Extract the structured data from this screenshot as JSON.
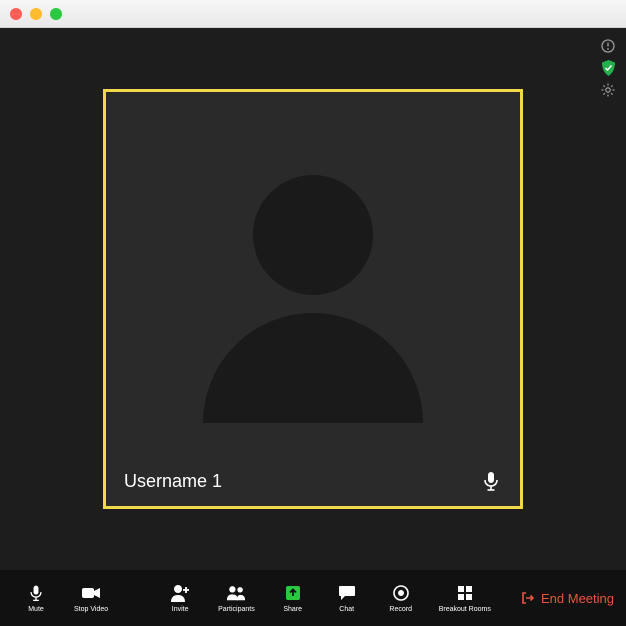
{
  "participant": {
    "name": "Username 1"
  },
  "toolbar": {
    "mute": "Mute",
    "stop_video": "Stop Video",
    "invite": "Invite",
    "participants": "Participants",
    "share": "Share",
    "chat": "Chat",
    "record": "Record",
    "breakout": "Breakout Rooms",
    "end": "End Meeting"
  },
  "colors": {
    "active_border": "#f2d94b",
    "share_accent": "#28c840",
    "end_accent": "#e85642",
    "shield": "#23b14d"
  }
}
